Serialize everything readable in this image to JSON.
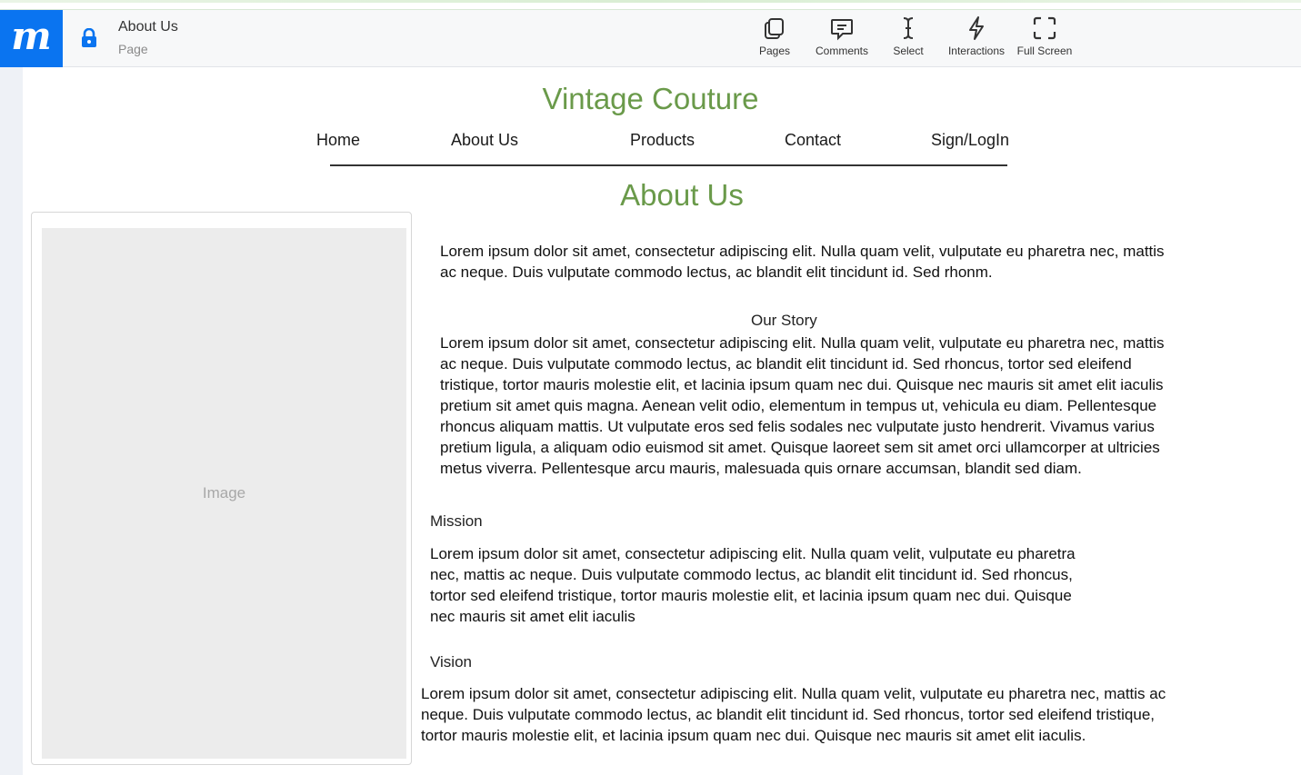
{
  "app_bar": {
    "logo_letter": "m",
    "page_name": "About Us",
    "page_type": "Page",
    "tools": [
      {
        "icon": "pages-icon",
        "label": "Pages"
      },
      {
        "icon": "comments-icon",
        "label": "Comments"
      },
      {
        "icon": "select-icon",
        "label": "Select"
      },
      {
        "icon": "interactions-icon",
        "label": "Interactions"
      },
      {
        "icon": "full-screen-icon",
        "label": "Full Screen"
      }
    ]
  },
  "site": {
    "title": "Vintage Couture",
    "title_color": "#6a9a4a",
    "nav": [
      "Home",
      "About Us",
      "Products",
      "Contact",
      "Sign/LogIn"
    ]
  },
  "about": {
    "heading": "About Us",
    "image_placeholder": "Image",
    "intro": "Lorem ipsum dolor sit amet, consectetur adipiscing elit. Nulla quam velit, vulputate eu pharetra nec, mattis ac neque. Duis vulputate commodo lectus, ac blandit elit tincidunt id. Sed rhonm.",
    "story_heading": "Our Story",
    "story": "Lorem ipsum dolor sit amet, consectetur adipiscing elit. Nulla quam velit, vulputate eu pharetra nec, mattis ac neque. Duis vulputate commodo lectus, ac blandit elit tincidunt id. Sed rhoncus, tortor sed eleifend tristique, tortor mauris molestie elit, et lacinia ipsum quam nec dui. Quisque nec mauris sit amet elit iaculis pretium sit amet quis magna. Aenean velit odio, elementum in tempus ut, vehicula eu diam. Pellentesque rhoncus aliquam mattis. Ut vulputate eros sed felis sodales nec vulputate justo hendrerit. Vivamus varius pretium ligula, a aliquam odio euismod sit amet. Quisque laoreet sem sit amet orci ullamcorper at ultricies metus viverra. Pellentesque arcu mauris, malesuada quis ornare accumsan, blandit sed diam.",
    "mission_heading": "Mission",
    "mission": "Lorem ipsum dolor sit amet, consectetur adipiscing elit. Nulla quam velit, vulputate eu pharetra nec, mattis ac neque. Duis vulputate commodo lectus, ac blandit elit tincidunt id. Sed rhoncus, tortor sed eleifend tristique, tortor mauris molestie elit, et lacinia ipsum quam nec dui. Quisque nec mauris sit amet elit iaculis",
    "vision_heading": "Vision",
    "vision": "Lorem ipsum dolor sit amet, consectetur adipiscing elit. Nulla quam velit, vulputate eu pharetra nec, mattis ac neque. Duis vulputate commodo lectus, ac blandit elit tincidunt id. Sed rhoncus, tortor sed eleifend tristique, tortor mauris molestie elit, et lacinia ipsum quam nec dui. Quisque nec mauris sit amet elit iaculis."
  }
}
